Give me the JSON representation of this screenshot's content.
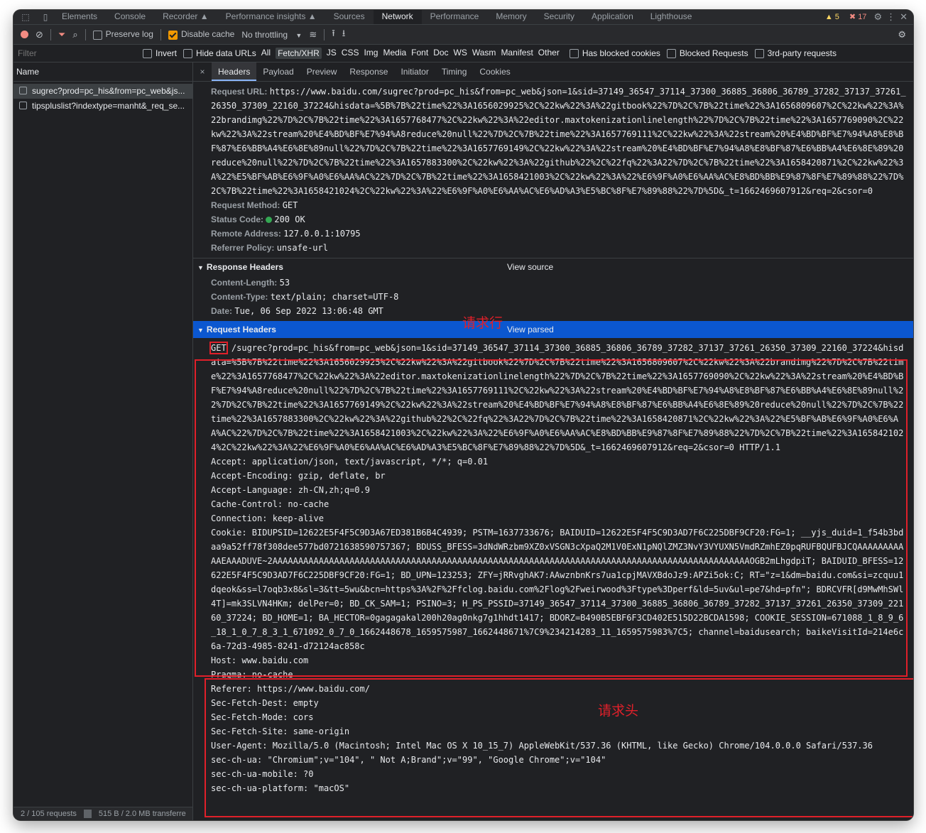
{
  "tabbar": {
    "tabs": [
      "Elements",
      "Console",
      "Recorder ▲",
      "Performance insights ▲",
      "Sources",
      "Network",
      "Performance",
      "Memory",
      "Security",
      "Application",
      "Lighthouse"
    ],
    "active_index": 5,
    "warnings": "5",
    "errors": "17"
  },
  "toolbar": {
    "preserve_log": "Preserve log",
    "disable_cache": "Disable cache",
    "throttling": "No throttling"
  },
  "filterbar": {
    "filter_placeholder": "Filter",
    "invert": "Invert",
    "hide_data_urls": "Hide data URLs",
    "types": [
      "All",
      "Fetch/XHR",
      "JS",
      "CSS",
      "Img",
      "Media",
      "Font",
      "Doc",
      "WS",
      "Wasm",
      "Manifest",
      "Other"
    ],
    "selected_type": "Fetch/XHR",
    "has_blocked_cookies": "Has blocked cookies",
    "blocked_requests": "Blocked Requests",
    "third_party": "3rd-party requests"
  },
  "requests": {
    "header": "Name",
    "items": [
      "sugrec?prod=pc_his&from=pc_web&js...",
      "tipspluslist?indextype=manht&_req_se..."
    ]
  },
  "statusbar": {
    "requests": "2 / 105 requests",
    "transferred": "515 B / 2.0 MB transferre"
  },
  "detail_tabs": [
    "Headers",
    "Payload",
    "Preview",
    "Response",
    "Initiator",
    "Timing",
    "Cookies"
  ],
  "general": {
    "url_label": "Request URL:",
    "url_value": "https://www.baidu.com/sugrec?prod=pc_his&from=pc_web&json=1&sid=37149_36547_37114_37300_36885_36806_36789_37282_37137_37261_26350_37309_22160_37224&hisdata=%5B%7B%22time%22%3A1656029925%2C%22kw%22%3A%22gitbook%22%7D%2C%7B%22time%22%3A1656809607%2C%22kw%22%3A%22brandimg%22%7D%2C%7B%22time%22%3A1657768477%2C%22kw%22%3A%22editor.maxtokenizationlinelength%22%7D%2C%7B%22time%22%3A1657769090%2C%22kw%22%3A%22stream%20%E4%BD%BF%E7%94%A8reduce%20null%22%7D%2C%7B%22time%22%3A1657769111%2C%22kw%22%3A%22stream%20%E4%BD%BF%E7%94%A8%E8%BF%87%E6%BB%A4%E6%8E%89null%22%7D%2C%7B%22time%22%3A1657769149%2C%22kw%22%3A%22stream%20%E4%BD%BF%E7%94%A8%E8%BF%87%E6%BB%A4%E6%8E%89%20reduce%20null%22%7D%2C%7B%22time%22%3A1657883300%2C%22kw%22%3A%22github%22%2C%22fq%22%3A22%7D%2C%7B%22time%22%3A1658420871%2C%22kw%22%3A%22%E5%BF%AB%E6%9F%A0%E6%AA%AC%22%7D%2C%7B%22time%22%3A1658421003%2C%22kw%22%3A%22%E6%9F%A0%E6%AA%AC%E8%BD%BB%E9%87%8F%E7%89%88%22%7D%2C%7B%22time%22%3A1658421024%2C%22kw%22%3A%22%E6%9F%A0%E6%AA%AC%E6%AD%A3%E5%BC%8F%E7%89%88%22%7D%5D&_t=1662469607912&req=2&csor=0",
    "method_label": "Request Method:",
    "method_value": "GET",
    "status_label": "Status Code:",
    "status_value": "200 OK",
    "remote_label": "Remote Address:",
    "remote_value": "127.0.0.1:10795",
    "referrer_label": "Referrer Policy:",
    "referrer_value": "unsafe-url",
    "status_color": "#34a853"
  },
  "response_headers": {
    "title": "Response Headers",
    "link": "View source",
    "items": [
      {
        "k": "Content-Length:",
        "v": "53"
      },
      {
        "k": "Content-Type:",
        "v": "text/plain; charset=UTF-8"
      },
      {
        "k": "Date:",
        "v": "Tue, 06 Sep 2022 13:06:48 GMT"
      }
    ]
  },
  "request_headers": {
    "title": "Request Headers",
    "link": "View parsed",
    "method": "GET",
    "request_line": " /sugrec?prod=pc_his&from=pc_web&json=1&sid=37149_36547_37114_37300_36885_36806_36789_37282_37137_37261_26350_37309_22160_37224&hisdata=%5B%7B%22time%22%3A1656029925%2C%22kw%22%3A%22gitbook%22%7D%2C%7B%22time%22%3A1656809607%2C%22kw%22%3A%22brandimg%22%7D%2C%7B%22time%22%3A1657768477%2C%22kw%22%3A%22editor.maxtokenizationlinelength%22%7D%2C%7B%22time%22%3A1657769090%2C%22kw%22%3A%22stream%20%E4%BD%BF%E7%94%A8reduce%20null%22%7D%2C%7B%22time%22%3A1657769111%2C%22kw%22%3A%22stream%20%E4%BD%BF%E7%94%A8%E8%BF%87%E6%BB%A4%E6%8E%89null%22%7D%2C%7B%22time%22%3A1657769149%2C%22kw%22%3A%22stream%20%E4%BD%BF%E7%94%A8%E8%BF%87%E6%BB%A4%E6%8E%89%20reduce%20null%22%7D%2C%7B%22time%22%3A1657883300%2C%22kw%22%3A%22github%22%2C%22fq%22%3A22%7D%2C%7B%22time%22%3A1658420871%2C%22kw%22%3A%22%E5%BF%AB%E6%9F%A0%E6%AA%AC%22%7D%2C%7B%22time%22%3A1658421003%2C%22kw%22%3A%22%E6%9F%A0%E6%AA%AC%E8%BD%BB%E9%87%8F%E7%89%88%22%7D%2C%7B%22time%22%3A1658421024%2C%22kw%22%3A%22%E6%9F%A0%E6%AA%AC%E6%AD%A3%E5%BC%8F%E7%89%88%22%7D%5D&_t=1662469607912&req=2&csor=0 HTTP/1.1",
    "lines_top": [
      "Accept: application/json, text/javascript, */*; q=0.01",
      "Accept-Encoding: gzip, deflate, br",
      "Accept-Language: zh-CN,zh;q=0.9",
      "Cache-Control: no-cache",
      "Connection: keep-alive",
      "Cookie: BIDUPSID=12622E5F4F5C9D3A67ED381B6B4C4939; PSTM=1637733676; BAIDUID=12622E5F4F5C9D3AD7F6C225DBF9CF20:FG=1; __yjs_duid=1_f54b3bdaa9a52ff78f308dee577bd0721638590757367; BDUSS_BFESS=3dNdWRzbm9XZ0xVSGN3cXpaQ2M1V0ExN1pNQlZMZ3NvY3VYUXN5VmdRZmhEZ0pqRUFBQUFBJCQAAAAAAAAAAAEAAADUVE~2AAAAAAAAAAAAAAAAAAAAAAAAAAAAAAAAAAAAAAAAAAAAAAAAAAAAAAAAAAAAAAAAAAAAAAAAAAAAAAAAAAAAAAAAAAAAAOGB2mLhgdpiT; BAIDUID_BFESS=12622E5F4F5C9D3AD7F6C225DBF9CF20:FG=1; BD_UPN=123253; ZFY=jRRvghAK7:AAwznbnKrs7ua1cpjMAVXBdoJz9:APZi5ok:C; RT=\"z=1&dm=baidu.com&si=zcquu1dqeok&ss=l7oqb3x8&sl=3&tt=5wu&bcn=https%3A%2F%2Ffclog.baidu.com%2Flog%2Fweirwood%3Ftype%3Dperf&ld=5uv&ul=pe7&hd=pfn\"; BDRCVFR[d9MwMhSWl4T]=mk3SLVN4HKm; delPer=0; BD_CK_SAM=1; PSINO=3; H_PS_PSSID=37149_36547_37114_37300_36885_36806_36789_37282_37137_37261_26350_37309_22160_37224; BD_HOME=1; BA_HECTOR=0gagagakal200h20ag0nkg7g1hhdt1417; BDORZ=B490B5EBF6F3CD402E515D22BCDA1598; COOKIE_SESSION=671088_1_8_9_6_18_1_0_7_8_3_1_671092_0_7_0_1662448678_1659575987_1662448671%7C9%234214283_11_1659575983%7C5; channel=baidusearch; baikeVisitId=214e6c6a-72d3-4985-8241-d72124ac858c"
    ],
    "lines_bottom": [
      "Host: www.baidu.com",
      "Pragma: no-cache",
      "Referer: https://www.baidu.com/",
      "Sec-Fetch-Dest: empty",
      "Sec-Fetch-Mode: cors",
      "Sec-Fetch-Site: same-origin",
      "User-Agent: Mozilla/5.0 (Macintosh; Intel Mac OS X 10_15_7) AppleWebKit/537.36 (KHTML, like Gecko) Chrome/104.0.0.0 Safari/537.36",
      "sec-ch-ua: \"Chromium\";v=\"104\", \" Not A;Brand\";v=\"99\", \"Google Chrome\";v=\"104\"",
      "sec-ch-ua-mobile: ?0",
      "sec-ch-ua-platform: \"macOS\""
    ]
  },
  "annotations": {
    "request_line": "请求行",
    "request_header": "请求头",
    "color": "#e0202a"
  }
}
